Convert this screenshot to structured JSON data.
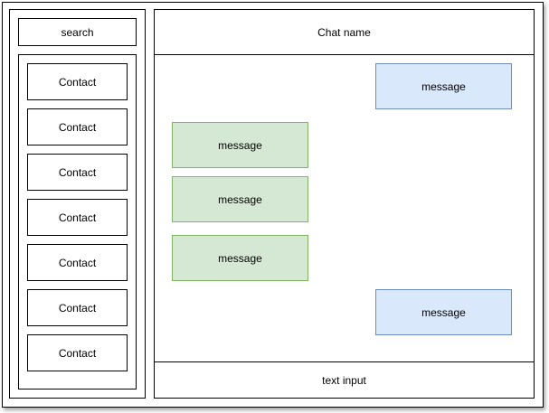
{
  "search": {
    "label": "search"
  },
  "contacts": [
    {
      "label": "Contact"
    },
    {
      "label": "Contact"
    },
    {
      "label": "Contact"
    },
    {
      "label": "Contact"
    },
    {
      "label": "Contact"
    },
    {
      "label": "Contact"
    },
    {
      "label": "Contact"
    }
  ],
  "chat": {
    "name": "Chat name",
    "messages": [
      {
        "text": "message",
        "direction": "outgoing",
        "fill": "#dae8fc",
        "stroke": "#6c8ebf"
      },
      {
        "text": "message",
        "direction": "incoming",
        "fill": "#d5e8d4",
        "stroke": "#82b366"
      },
      {
        "text": "message",
        "direction": "incoming",
        "fill": "#d5e8d4",
        "stroke": "#82b366"
      },
      {
        "text": "message",
        "direction": "incoming",
        "fill": "#d5e8d4",
        "stroke": "#82b366"
      },
      {
        "text": "message",
        "direction": "outgoing",
        "fill": "#dae8fc",
        "stroke": "#6c8ebf"
      }
    ],
    "input": {
      "label": "text input"
    }
  }
}
